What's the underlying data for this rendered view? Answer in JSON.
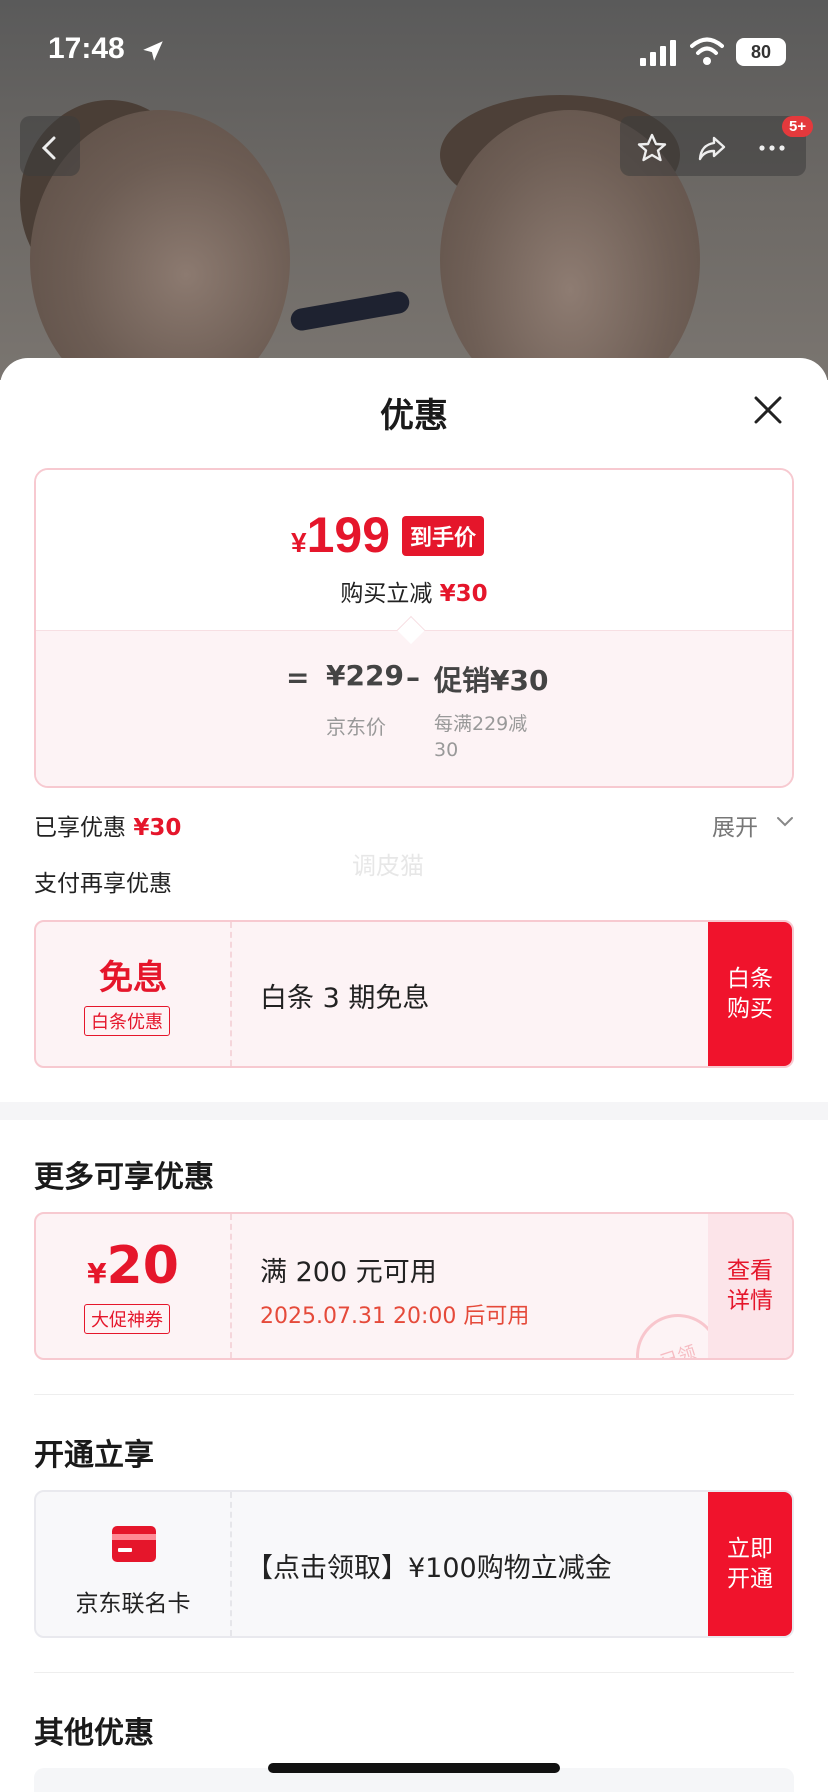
{
  "status": {
    "time": "17:48",
    "battery": "80"
  },
  "nav": {
    "cart_badge": "5+"
  },
  "sheet": {
    "title": "优惠",
    "final_price_yen": "¥",
    "final_price_value": "199",
    "final_price_tag": "到手价",
    "reduce_label": "购买立减",
    "reduce_value": "¥30",
    "equals": "=",
    "jd_price": "¥229",
    "minus": "–",
    "promo": "促销¥30",
    "jd_price_label": "京东价",
    "promo_desc": "每满229减30",
    "enjoyed_label": "已享优惠",
    "enjoyed_value": "¥30",
    "expand_label": "展开",
    "pay_more_label": "支付再享优惠",
    "watermark": "调皮猫"
  },
  "baitiao_card": {
    "big": "免息",
    "tag": "白条优惠",
    "text": "白条 3 期免息",
    "button": "白条购买"
  },
  "more": {
    "title": "更多可享优惠",
    "coupon_yen": "¥",
    "coupon_value": "20",
    "coupon_tag": "大促神券",
    "coupon_text": "满 200 元可用",
    "coupon_time": "2025.07.31 20:00 后可用",
    "coupon_button": "查看详情",
    "stamp": "已领"
  },
  "open": {
    "title": "开通立享",
    "card_name": "京东联名卡",
    "text": "【点击领取】¥100购物立减金",
    "button": "立即开通"
  },
  "other": {
    "title": "其他优惠"
  },
  "colors": {
    "accent": "#e5162b",
    "button_red": "#f0132c",
    "pink_bg": "#fdf3f5",
    "pink_border": "#f7c9d0"
  }
}
